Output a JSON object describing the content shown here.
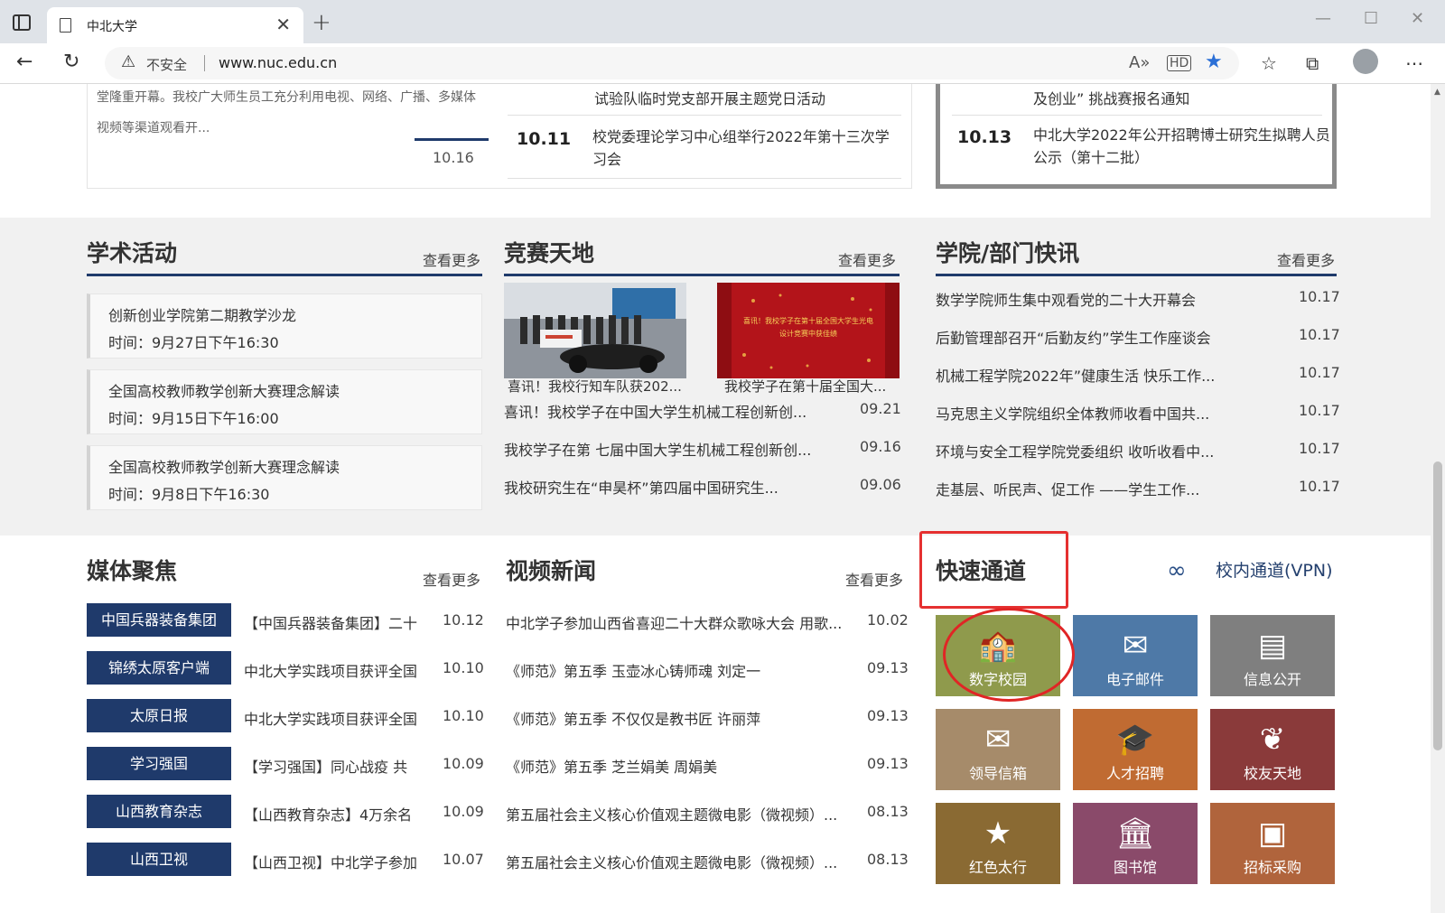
{
  "browser": {
    "tab_title": "中北大学",
    "tab_close": "✕",
    "new_tab": "+",
    "insecure_label": "不安全",
    "url": "www.nuc.edu.cn"
  },
  "top_news": {
    "intro": "堂隆重开幕。我校广大师生员工充分利用电视、网络、广播、多媒体视频等渠道观看开...",
    "date_small": "10.16",
    "rows": [
      {
        "date": "",
        "title": "试验队临时党支部开展主题党日活动"
      },
      {
        "date": "10.11",
        "title": "校党委理论学习中心组举行2022年第十三次学习会"
      }
    ],
    "notices": [
      {
        "date": "",
        "title": "及创业” 挑战赛报名通知"
      },
      {
        "date": "10.13",
        "title": "中北大学2022年公开招聘博士研究生拟聘人员公示（第十二批）"
      }
    ]
  },
  "academic": {
    "title": "学术活动",
    "more": "查看更多",
    "items": [
      {
        "name": "创新创业学院第二期教学沙龙",
        "time": "时间：9月27日下午16:30"
      },
      {
        "name": "全国高校教师教学创新大赛理念解读",
        "time": "时间：9月15日下午16:00"
      },
      {
        "name": "全国高校教师教学创新大赛理念解读",
        "time": "时间：9月8日下午16:30"
      }
    ]
  },
  "competition": {
    "title": "竞赛天地",
    "more": "查看更多",
    "image_captions": [
      "喜讯！我校行知车队获202...",
      "我校学子在第十届全国大..."
    ],
    "banner_text": "喜讯！我校学子在第十届全国大学生光电设计竞赛中获佳绩",
    "items": [
      {
        "title": "喜讯！我校学子在中国大学生机械工程创新创...",
        "date": "09.21"
      },
      {
        "title": "我校学子在第 七届中国大学生机械工程创新创...",
        "date": "09.16"
      },
      {
        "title": "我校研究生在“申昊杯”第四届中国研究生...",
        "date": "09.06"
      }
    ]
  },
  "dept_news": {
    "title": "学院/部门快讯",
    "more": "查看更多",
    "items": [
      {
        "title": "数学学院师生集中观看党的二十大开幕会",
        "date": "10.17"
      },
      {
        "title": "后勤管理部召开“后勤友约”学生工作座谈会",
        "date": "10.17"
      },
      {
        "title": "机械工程学院2022年”健康生活 快乐工作...",
        "date": "10.17"
      },
      {
        "title": "马克思主义学院组织全体教师收看中国共...",
        "date": "10.17"
      },
      {
        "title": "环境与安全工程学院党委组织 收听收看中...",
        "date": "10.17"
      },
      {
        "title": "走基层、听民声、促工作 ——学生工作...",
        "date": "10.17"
      }
    ]
  },
  "media": {
    "title": "媒体聚焦",
    "more": "查看更多",
    "items": [
      {
        "source": "中国兵器装备集团",
        "title": "【中国兵器装备集团】二十",
        "date": "10.12"
      },
      {
        "source": "锦绣太原客户端",
        "title": "中北大学实践项目获评全国",
        "date": "10.10"
      },
      {
        "source": "太原日报",
        "title": "中北大学实践项目获评全国",
        "date": "10.10"
      },
      {
        "source": "学习强国",
        "title": "【学习强国】同心战疫 共",
        "date": "10.09"
      },
      {
        "source": "山西教育杂志",
        "title": "【山西教育杂志】4万余名",
        "date": "10.09"
      },
      {
        "source": "山西卫视",
        "title": "【山西卫视】中北学子参加",
        "date": "10.07"
      }
    ]
  },
  "video": {
    "title": "视频新闻",
    "more": "查看更多",
    "items": [
      {
        "title": "中北学子参加山西省喜迎二十大群众歌咏大会 用歌...",
        "date": "10.02"
      },
      {
        "title": "《师范》第五季 玉壶冰心铸师魂 刘定一",
        "date": "09.13"
      },
      {
        "title": "《师范》第五季 不仅仅是教书匠 许丽萍",
        "date": "09.13"
      },
      {
        "title": "《师范》第五季 芝兰娟美 周娟美",
        "date": "09.13"
      },
      {
        "title": "第五届社会主义核心价值观主题微电影（微视频）...",
        "date": "08.13"
      },
      {
        "title": "第五届社会主义核心价值观主题微电影（微视频）...",
        "date": "08.13"
      }
    ]
  },
  "quick": {
    "title": "快速通道",
    "vpn": "校内通道(VPN)",
    "tiles": [
      {
        "label": "数字校园",
        "icon": "🏫",
        "color": "#8f9a4c"
      },
      {
        "label": "电子邮件",
        "icon": "✉",
        "color": "#4e79a7"
      },
      {
        "label": "信息公开",
        "icon": "▤",
        "color": "#7f7f7f"
      },
      {
        "label": "领导信箱",
        "icon": "✉",
        "color": "#a68b6a"
      },
      {
        "label": "人才招聘",
        "icon": "🎓",
        "color": "#c06b32"
      },
      {
        "label": "校友天地",
        "icon": "❦",
        "color": "#8a3a3a"
      },
      {
        "label": "红色太行",
        "icon": "★",
        "color": "#8a6a33"
      },
      {
        "label": "图书馆",
        "icon": "🏛",
        "color": "#8a4a6a"
      },
      {
        "label": "招标采购",
        "icon": "▣",
        "color": "#b0643c"
      }
    ]
  }
}
